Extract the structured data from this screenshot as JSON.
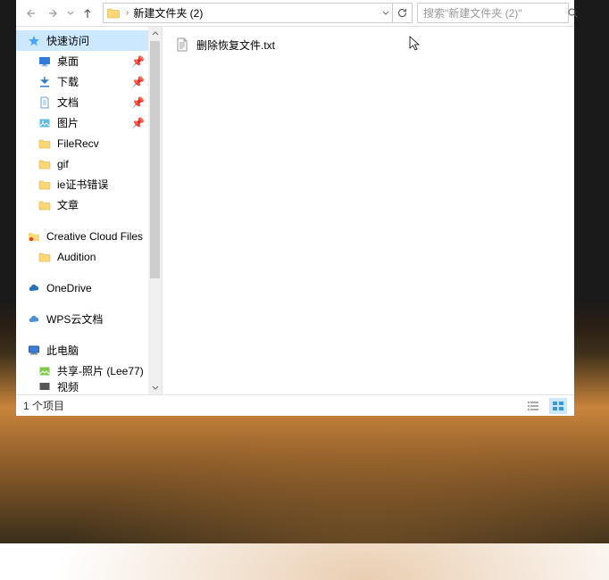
{
  "address": {
    "current": "新建文件夹 (2)"
  },
  "search": {
    "placeholder": "搜索\"新建文件夹 (2)\""
  },
  "sidebar": {
    "quick_access": "快速访问",
    "desktop": "桌面",
    "downloads": "下载",
    "documents": "文档",
    "pictures": "图片",
    "filerecv": "FileRecv",
    "gif": "gif",
    "iecert": "ie证书错误",
    "articles": "文章",
    "creative_cloud": "Creative Cloud Files",
    "audition": "Audition",
    "onedrive": "OneDrive",
    "wps_cloud": "WPS云文档",
    "this_pc": "此电脑",
    "shared_photos": "共享-照片 (Lee77)",
    "videos": "视频"
  },
  "files": [
    {
      "name": "删除恢复文件.txt"
    }
  ],
  "status": {
    "item_count": "1 个项目"
  }
}
